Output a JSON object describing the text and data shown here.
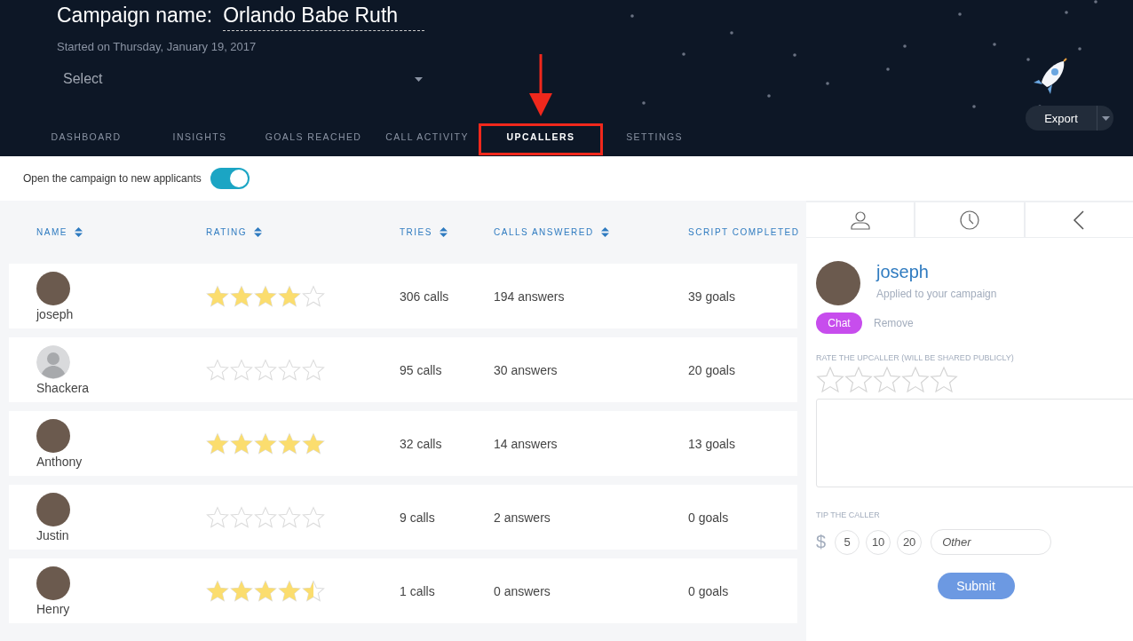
{
  "header": {
    "campaign_label": "Campaign name:",
    "campaign_name": "Orlando Babe Ruth",
    "started": "Started on Thursday, January 19, 2017",
    "select": {
      "placeholder": "Select"
    },
    "export_button": "Export"
  },
  "tabs": [
    {
      "label": "DASHBOARD",
      "selected": false,
      "annotated": false
    },
    {
      "label": "INSIGHTS",
      "selected": false,
      "annotated": false
    },
    {
      "label": "GOALS REACHED",
      "selected": false,
      "annotated": false
    },
    {
      "label": "CALL ACTIVITY",
      "selected": false,
      "annotated": false
    },
    {
      "label": "UPCALLERS",
      "selected": true,
      "annotated": true
    },
    {
      "label": "SETTINGS",
      "selected": false,
      "annotated": false
    }
  ],
  "open_toggle": {
    "label": "Open the campaign to new applicants",
    "on": true
  },
  "table": {
    "columns": [
      {
        "label": "NAME",
        "sortable": true
      },
      {
        "label": "RATING",
        "sortable": true
      },
      {
        "label": "TRIES",
        "sortable": true
      },
      {
        "label": "CALLS ANSWERED",
        "sortable": true
      },
      {
        "label": "SCRIPT COMPLETED",
        "sortable": false
      }
    ],
    "rows": [
      {
        "name": "joseph",
        "has_photo": true,
        "stars": 4,
        "tries": "306 calls",
        "answers": "194 answers",
        "goals": "39 goals"
      },
      {
        "name": "Shackera",
        "has_photo": false,
        "stars": 0,
        "tries": "95 calls",
        "answers": "30 answers",
        "goals": "20 goals"
      },
      {
        "name": "Anthony",
        "has_photo": true,
        "stars": 5,
        "tries": "32 calls",
        "answers": "14 answers",
        "goals": "13 goals"
      },
      {
        "name": "Justin",
        "has_photo": true,
        "stars": 0,
        "tries": "9 calls",
        "answers": "2 answers",
        "goals": "0 goals"
      },
      {
        "name": "Henry",
        "has_photo": true,
        "stars": 4.5,
        "tries": "1 calls",
        "answers": "0 answers",
        "goals": "0 goals"
      }
    ]
  },
  "panel": {
    "name": "joseph",
    "subtitle": "Applied to your campaign",
    "chat_button": "Chat",
    "remove_link": "Remove",
    "rate_label": "RATE THE UPCALLER (WILL BE SHARED PUBLICLY)",
    "stars": 0,
    "tip_label": "TIP THE CALLER",
    "currency": "$",
    "tips": [
      "5",
      "10",
      "20"
    ],
    "other": {
      "placeholder": "Other"
    },
    "submit_button": "Submit"
  }
}
